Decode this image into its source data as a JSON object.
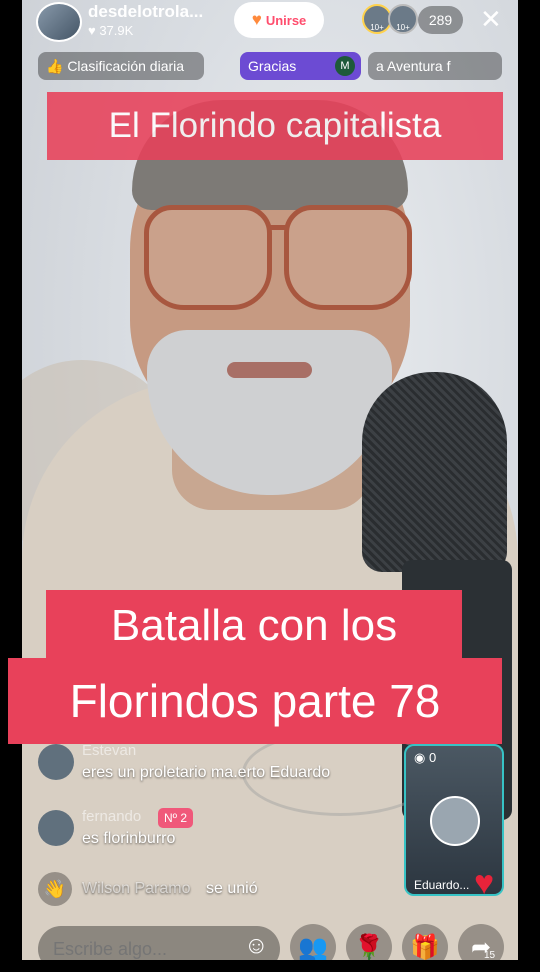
{
  "header": {
    "username": "desdelotrola...",
    "likes": "♥ 37.9K",
    "join_label": "Unirse",
    "viewer_badge_a": "10+",
    "viewer_badge_b": "10+",
    "viewer_count": "289",
    "close_icon": "close-icon"
  },
  "pills": {
    "ranking": "👍 Clasificación diaria",
    "thanks": "Gracias",
    "thanks_badge": "M",
    "adventure": "a    Aventura f"
  },
  "captions": {
    "top": "El Florindo capitalista",
    "line1": "Batalla con los",
    "line2": "Florindos parte 78"
  },
  "chat": [
    {
      "name": "Estevan",
      "message": "eres un proletario ma.erto Eduardo"
    },
    {
      "name": "fernando",
      "badge": "Nº 2",
      "message": "es florinburro"
    },
    {
      "name": "Wilson Paramo",
      "message": "se unió"
    }
  ],
  "mini_window": {
    "count": "◉ 0",
    "name": "Eduardo..."
  },
  "bottom": {
    "placeholder": "Escribe algo...",
    "share_count": "15"
  },
  "colors": {
    "caption_bg": "#e8415a",
    "thanks_pill": "#6c4bd3",
    "mini_border": "#37c3c5"
  }
}
